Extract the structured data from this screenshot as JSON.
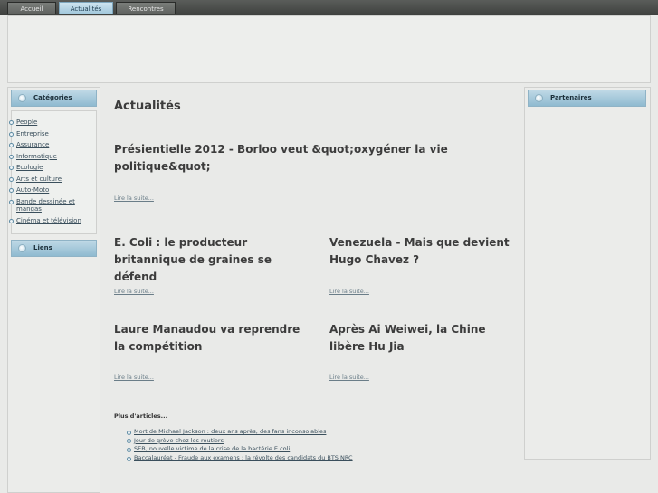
{
  "nav": {
    "tabs": [
      {
        "label": "Accueil"
      },
      {
        "label": "Actualités"
      },
      {
        "label": "Rencontres"
      }
    ]
  },
  "sidebar": {
    "categories_title": "Catégories",
    "categories": [
      {
        "label": "People"
      },
      {
        "label": "Entreprise"
      },
      {
        "label": "Assurance"
      },
      {
        "label": "Informatique"
      },
      {
        "label": "Ecologie"
      },
      {
        "label": "Arts et culture"
      },
      {
        "label": "Auto-Moto"
      },
      {
        "label": "Bande dessinée et mangas"
      },
      {
        "label": "Cinéma et télévision"
      }
    ],
    "links_title": "Liens"
  },
  "right": {
    "partners_title": "Partenaires"
  },
  "main": {
    "title": "Actualités",
    "read_more": "Lire la suite...",
    "articles": [
      {
        "title": "Présientielle 2012 - Borloo veut &quot;oxygéner la vie politique&quot;"
      },
      {
        "title": "E. Coli : le producteur britannique de graines se défend"
      },
      {
        "title": "Venezuela - Mais que devient Hugo Chavez ?"
      },
      {
        "title": "Laure Manaudou va reprendre la compétition"
      },
      {
        "title": "Après Ai Weiwei, la Chine libère Hu Jia"
      }
    ],
    "more_title": "Plus d'articles...",
    "more_articles": [
      {
        "label": "Mort de Michael Jackson : deux ans après, des fans inconsolables"
      },
      {
        "label": "Jour de grève chez les routiers"
      },
      {
        "label": "SEB, nouvelle victime de la crise de la bactérie E.coli"
      },
      {
        "label": "Baccalauréat - Fraude aux examens : la révolte des candidats du BTS NRC"
      }
    ]
  }
}
